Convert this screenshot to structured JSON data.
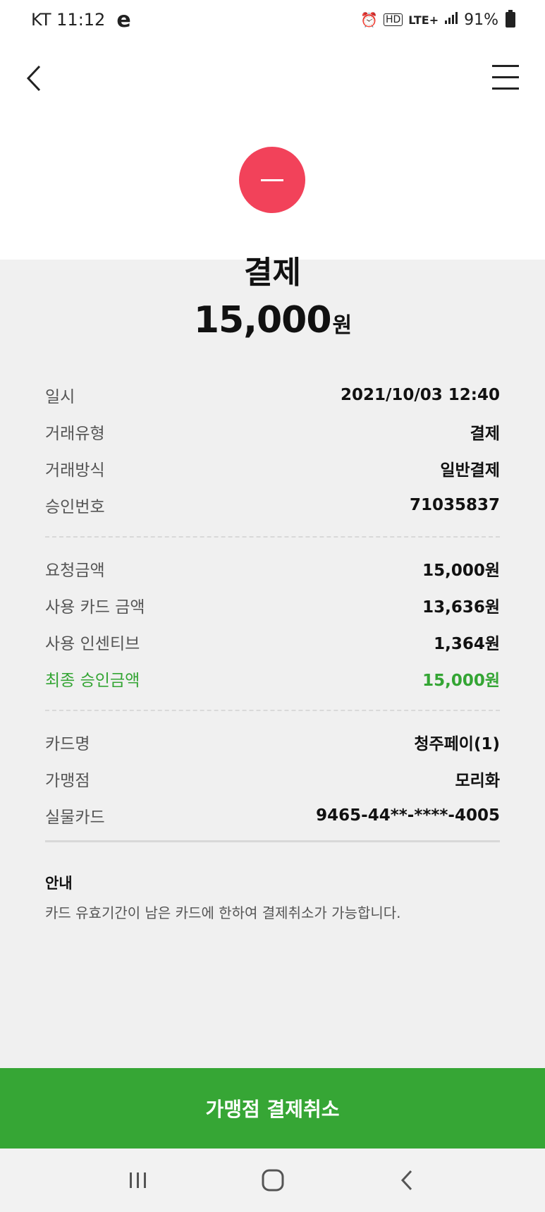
{
  "status_bar": {
    "carrier_time": "KT 11:12",
    "e_icon": "e",
    "network": "LTE+",
    "battery": "91%",
    "icons": [
      "alarm-icon",
      "hd-icon",
      "signal-icon",
      "battery-icon"
    ]
  },
  "header": {
    "back_icon": "chevron-left-icon",
    "menu_icon": "hamburger-menu-icon"
  },
  "transaction": {
    "icon": "minus-circle-icon",
    "icon_color": "#f2425a",
    "title": "결제",
    "amount": "15,000",
    "unit": "원"
  },
  "details": {
    "group1": [
      {
        "label": "일시",
        "value": "2021/10/03 12:40"
      },
      {
        "label": "거래유형",
        "value": "결제"
      },
      {
        "label": "거래방식",
        "value": "일반결제"
      },
      {
        "label": "승인번호",
        "value": "71035837"
      }
    ],
    "group2": [
      {
        "label": "요청금액",
        "value": "15,000원"
      },
      {
        "label": "사용 카드 금액",
        "value": "13,636원"
      },
      {
        "label": "사용 인센티브",
        "value": "1,364원"
      },
      {
        "label": "최종 승인금액",
        "value": "15,000원"
      }
    ],
    "group3": [
      {
        "label": "카드명",
        "value": "청주페이(1)"
      },
      {
        "label": "가맹점",
        "value": "모리화"
      },
      {
        "label": "실물카드",
        "value": "9465-44**-****-4005"
      }
    ]
  },
  "info": {
    "title": "안내",
    "text": "카드 유효기간이 남은 카드에 한하여 결제취소가 가능합니다."
  },
  "action": {
    "cancel_label": "가맹점 결제취소"
  },
  "colors": {
    "accent_green": "#36a635",
    "highlight_green": "#34a534",
    "minus_red": "#f2425a"
  },
  "nav": {
    "icons": [
      "recent-apps-icon",
      "home-icon",
      "back-icon"
    ]
  }
}
